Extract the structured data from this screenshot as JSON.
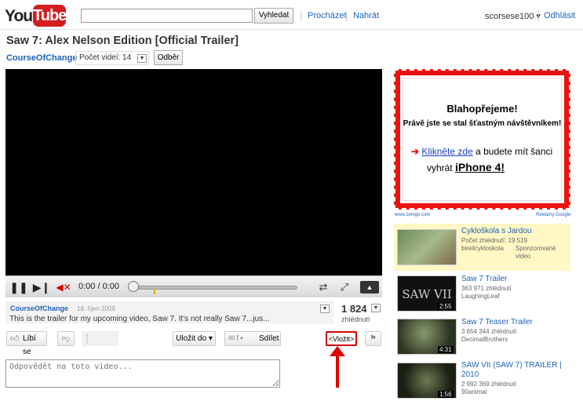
{
  "header": {
    "logo_you": "You",
    "logo_tube": "Tube",
    "search_value": "",
    "search_button": "Vyhledat",
    "nav_browse": "Procházet",
    "nav_upload": "Nahrát",
    "username": "scorsese100 ▾",
    "logout": "Odhlásit"
  },
  "video": {
    "title": "Saw 7: Alex Nelson Edition [Official Trailer]",
    "channel": "CourseOfChange",
    "videos_dropdown": "Počet videí: 14",
    "subscribe": "Odběr",
    "time": "0:00 / 0:00",
    "progress": 0
  },
  "info": {
    "channel": "CourseOfChange",
    "date": "18. říjen 2009",
    "description": "This is the trailer for my upcoming video, Saw 7. It's not really Saw 7...jus...",
    "views": "1 824",
    "views_label": "zhlédnutí"
  },
  "actions": {
    "like": "Líbí se",
    "save": "Uložit do ▾",
    "share": "Sdílet",
    "embed": "<Vložit>"
  },
  "comment": {
    "placeholder": "Odpovědět na toto video..."
  },
  "ad": {
    "headline": "Blahopřejeme!",
    "subline": "Právě jste se stal šťastným návštěvníkem!",
    "link": "Klikněte zde",
    "line1_rest": " a budete mít šanci",
    "line2_pre": "vyhrát ",
    "prize": "iPhone 4!",
    "source": "www.zemgo.com",
    "google": "Reklamy Google"
  },
  "sidebar": {
    "sponsored": {
      "title": "Cykloškola s Jardou",
      "views": "Počet zhlédnutí: 19 519",
      "author": "bireilcykloskola",
      "tag": "Sponzorované video"
    },
    "related": [
      {
        "title": "Saw 7 Trailer",
        "views": "363 971 zhlédnutí",
        "author": "LaughingLeaf",
        "duration": "2:55",
        "thumb_text": "SAW VII"
      },
      {
        "title": "Saw 7 Teaser Trailer",
        "views": "3 654 344 zhlédnutí",
        "author": "DecimalBrothers",
        "duration": "4:31",
        "thumb_text": ""
      },
      {
        "title": "SAW VII (SAW 7) TRAILER | 2010",
        "views": "2 992 369 zhlédnutí",
        "author": "90animal",
        "duration": "1:56",
        "thumb_text": ""
      }
    ]
  },
  "colors": {
    "brand_red": "#d21e1e",
    "link_blue": "#1c62b9",
    "annotation_red": "#e00000",
    "sponsored_bg": "#fff7c4"
  }
}
